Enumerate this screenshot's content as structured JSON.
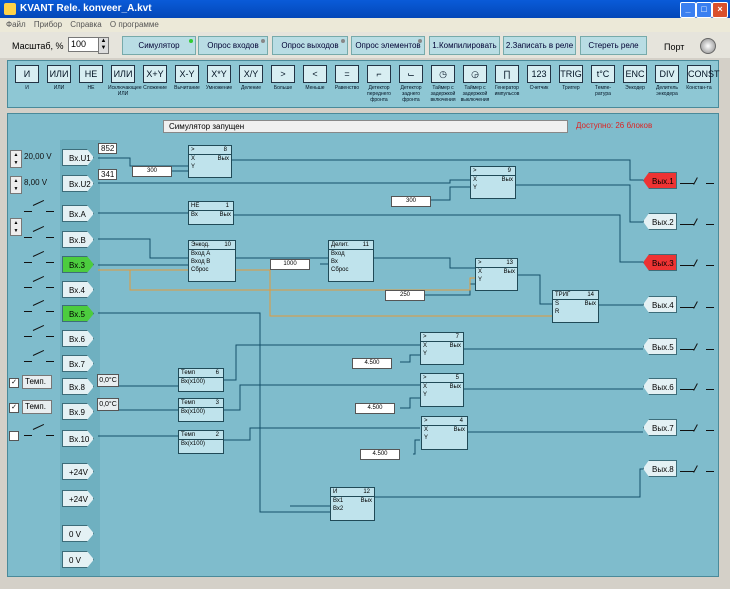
{
  "window": {
    "title": "KVANT Rele. konveer_A.kvt"
  },
  "menu": [
    "Файл",
    "Прибор",
    "Справка",
    "О программе"
  ],
  "toolbar": {
    "scale_label": "Масштаб, %",
    "scale_value": "100",
    "buttons": [
      "Симулятор",
      "Опрос входов",
      "Опрос выходов",
      "Опрос элементов",
      "1.Компилировать",
      "2.Записать в реле",
      "Стереть реле"
    ],
    "port_label": "Порт"
  },
  "palette": [
    {
      "sym": "И",
      "label": "И"
    },
    {
      "sym": "ИЛИ",
      "label": "ИЛИ"
    },
    {
      "sym": "НЕ",
      "label": "НЕ"
    },
    {
      "sym": "ИЛИ",
      "label": "Исключающее ИЛИ"
    },
    {
      "sym": "X+Y",
      "label": "Сложение"
    },
    {
      "sym": "X-Y",
      "label": "Вычитание"
    },
    {
      "sym": "X*Y",
      "label": "Умножение"
    },
    {
      "sym": "X/Y",
      "label": "Деление"
    },
    {
      "sym": ">",
      "label": "Больше"
    },
    {
      "sym": "<",
      "label": "Меньше"
    },
    {
      "sym": "=",
      "label": "Равенство"
    },
    {
      "sym": "⌐",
      "label": "Детектор переднего фронта"
    },
    {
      "sym": "⌙",
      "label": "Детектор заднего фронта"
    },
    {
      "sym": "◷",
      "label": "Таймер с задержкой включения"
    },
    {
      "sym": "◶",
      "label": "Таймер с задержкой выключения"
    },
    {
      "sym": "∏",
      "label": "Генератор импульсов"
    },
    {
      "sym": "123",
      "label": "Счетчик"
    },
    {
      "sym": "TRIG",
      "label": "Триггер"
    },
    {
      "sym": "t°C",
      "label": "Темпе-ратура"
    },
    {
      "sym": "ENC",
      "label": "Энкодер"
    },
    {
      "sym": "DIV",
      "label": "Делитель энкодера"
    },
    {
      "sym": "CONST",
      "label": "Констан-та"
    }
  ],
  "status": {
    "message": "Симулятор запущен",
    "available": "Доступно: 26 блоков"
  },
  "inputs": {
    "analog": [
      {
        "label": "Вх.U1",
        "value": "20,00 V",
        "reading": "852"
      },
      {
        "label": "Вх.U2",
        "value": "8,00 V",
        "reading": "341"
      }
    ],
    "digital": [
      {
        "label": "Вх.A",
        "active": false
      },
      {
        "label": "Вх.B",
        "active": false
      },
      {
        "label": "Вх.3",
        "active": true
      },
      {
        "label": "Вх.4",
        "active": false
      },
      {
        "label": "Вх.5",
        "active": true
      },
      {
        "label": "Вх.6",
        "active": false
      },
      {
        "label": "Вх.7",
        "active": false
      },
      {
        "label": "Вх.8",
        "active": false
      },
      {
        "label": "Вх.9",
        "active": false
      },
      {
        "label": "Вх.10",
        "active": false
      }
    ],
    "temp_toggle": [
      {
        "label": "Темп.",
        "checked": true,
        "value": "0,0°C"
      },
      {
        "label": "Темп.",
        "checked": true,
        "value": "0,0°C"
      },
      {
        "label": "Темп.",
        "checked": false,
        "value": ""
      }
    ],
    "power": [
      "+24V",
      "+24V",
      "0 V",
      "0 V"
    ]
  },
  "outputs": [
    {
      "label": "Вых.1",
      "active": true
    },
    {
      "label": "Вых.2",
      "active": false
    },
    {
      "label": "Вых.3",
      "active": true
    },
    {
      "label": "Вых.4",
      "active": false
    },
    {
      "label": "Вых.5",
      "active": false
    },
    {
      "label": "Вых.6",
      "active": false
    },
    {
      "label": "Вых.7",
      "active": false
    },
    {
      "label": "Вых.8",
      "active": false
    }
  ],
  "blocks": [
    {
      "id": "8",
      "name": ">",
      "rows": [
        "X",
        "Y"
      ],
      "out": "Вых"
    },
    {
      "id": "9",
      "name": ">",
      "rows": [
        "X",
        "Y"
      ],
      "out": "Вых"
    },
    {
      "id": "1",
      "name": "НЕ",
      "rows": [
        "Вх"
      ],
      "out": "Вых"
    },
    {
      "id": "10",
      "name": "Энкод.",
      "rows": [
        "Вход A",
        "Вход B",
        "Сброс"
      ],
      "out": "Вперёд"
    },
    {
      "id": "11",
      "name": "Делит.",
      "rows": [
        "Вход",
        "Вх",
        "Сброс"
      ],
      "out": "Вых"
    },
    {
      "id": "13",
      "name": ">",
      "rows": [
        "X",
        "Y"
      ],
      "out": "Вых"
    },
    {
      "id": "14",
      "name": "ТРИГ",
      "rows": [
        "S",
        "R"
      ],
      "out": "Вых"
    },
    {
      "id": "7",
      "name": ">",
      "rows": [
        "X",
        "Y"
      ],
      "out": "Вых"
    },
    {
      "id": "5",
      "name": ">",
      "rows": [
        "X",
        "Y"
      ],
      "out": "Вых"
    },
    {
      "id": "4",
      "name": ">",
      "rows": [
        "X",
        "Y"
      ],
      "out": "Вых"
    },
    {
      "id": "6",
      "name": "Темп",
      "rows": [
        "Вх(х100)"
      ],
      "out": "Вых"
    },
    {
      "id": "3",
      "name": "Темп",
      "rows": [
        "Вх(х100)"
      ],
      "out": "Вых"
    },
    {
      "id": "2",
      "name": "Темп",
      "rows": [
        "Вх(х100)"
      ],
      "out": "Вых"
    },
    {
      "id": "12",
      "name": "И",
      "rows": [
        "Вх1",
        "Вх2"
      ],
      "out": "Вых"
    }
  ],
  "constants": [
    "300",
    "300",
    "1000",
    "250",
    "4.500",
    "4.500",
    "4.500"
  ],
  "colors": {
    "workspace": "#7fbccc",
    "active_input": "#4ccc3e",
    "active_output": "#e33333",
    "wire": "#14506a",
    "wire_orange": "#e39a3a"
  }
}
